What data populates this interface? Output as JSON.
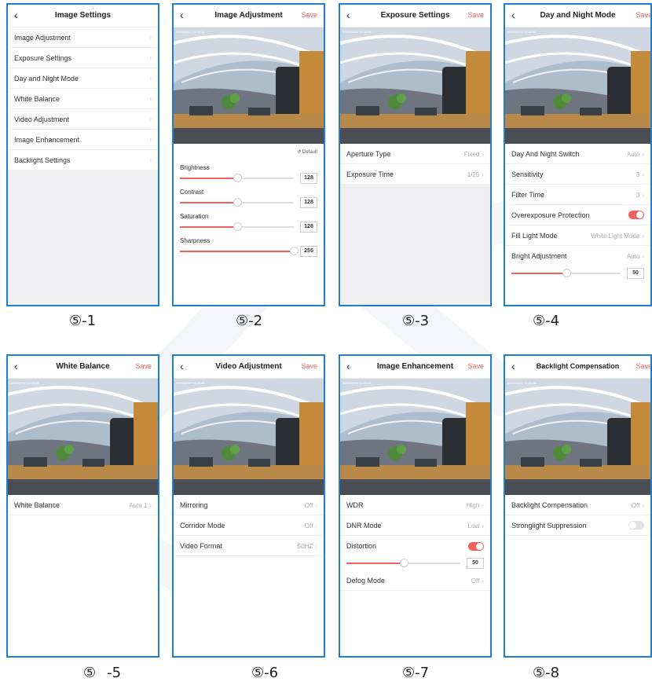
{
  "accent_color": "#f1615f",
  "border_color": "#1e7fd0",
  "timestamp": "2020/08/22 11:28:48",
  "panel1": {
    "title": "Image Settings",
    "items": [
      "Image Adjustment",
      "Exposure Settings",
      "Day and Night Mode",
      "White Balance",
      "Video Adjustment",
      "Image Enhancement",
      "Backlight Settings"
    ],
    "caption": "⑤-1"
  },
  "panel2": {
    "title": "Image Adjustment",
    "save": "Save",
    "default_label": "Default",
    "sliders": [
      {
        "label": "Brightness",
        "value": "128",
        "fraction": 0.5
      },
      {
        "label": "Contrast",
        "value": "128",
        "fraction": 0.5
      },
      {
        "label": "Saturation",
        "value": "128",
        "fraction": 0.5
      },
      {
        "label": "Sharpness",
        "value": "255",
        "fraction": 1.0
      }
    ],
    "caption": "⑤-2"
  },
  "panel3": {
    "title": "Exposure Settings",
    "save": "Save",
    "rows": [
      {
        "label": "Aperture Type",
        "value": "Fixed"
      },
      {
        "label": "Exposure Time",
        "value": "1/25"
      }
    ],
    "caption": "⑤-3"
  },
  "panel4": {
    "title": "Day and Night Mode",
    "save": "Save",
    "rows": [
      {
        "label": "Day And Night Switch",
        "value": "Auto"
      },
      {
        "label": "Sensitivity",
        "value": "3"
      },
      {
        "label": "Filter Time",
        "value": "3"
      },
      {
        "label": "Overexposure Protection",
        "toggle": true
      },
      {
        "label": "Fill Light Mode",
        "value": "White Light Mode"
      },
      {
        "label": "Bright Adjustment",
        "value": "Auto"
      }
    ],
    "slider": {
      "value": "50",
      "fraction": 0.5
    },
    "caption": "⑤-4"
  },
  "panel5": {
    "title": "White Balance",
    "save": "Save",
    "rows": [
      {
        "label": "White Balance",
        "value": "Auto 1"
      }
    ],
    "caption_main": "⑤",
    "caption_suffix": "-5"
  },
  "panel6": {
    "title": "Video Adjustment",
    "save": "Save",
    "rows": [
      {
        "label": "Mirroring",
        "value": "Off"
      },
      {
        "label": "Corridor Mode",
        "value": "Off"
      },
      {
        "label": "Video Format",
        "value": "50HZ"
      }
    ],
    "caption": "⑤-6"
  },
  "panel7": {
    "title": "Image Enhancement",
    "save": "Save",
    "rows": [
      {
        "label": "WDR",
        "value": "High"
      },
      {
        "label": "DNR Mode",
        "value": "Low"
      },
      {
        "label": "Distortion",
        "toggle": true
      }
    ],
    "slider": {
      "value": "50",
      "fraction": 0.5
    },
    "defog": {
      "label": "Defog Mode",
      "value": "Off"
    },
    "caption": "⑤-7"
  },
  "panel8": {
    "title": "Backlight Compensation",
    "save": "Save",
    "rows": [
      {
        "label": "Backlight Compensation",
        "value": "Off"
      },
      {
        "label": "Stronglight Suppression",
        "toggle": false
      }
    ],
    "caption": "⑤-8"
  }
}
